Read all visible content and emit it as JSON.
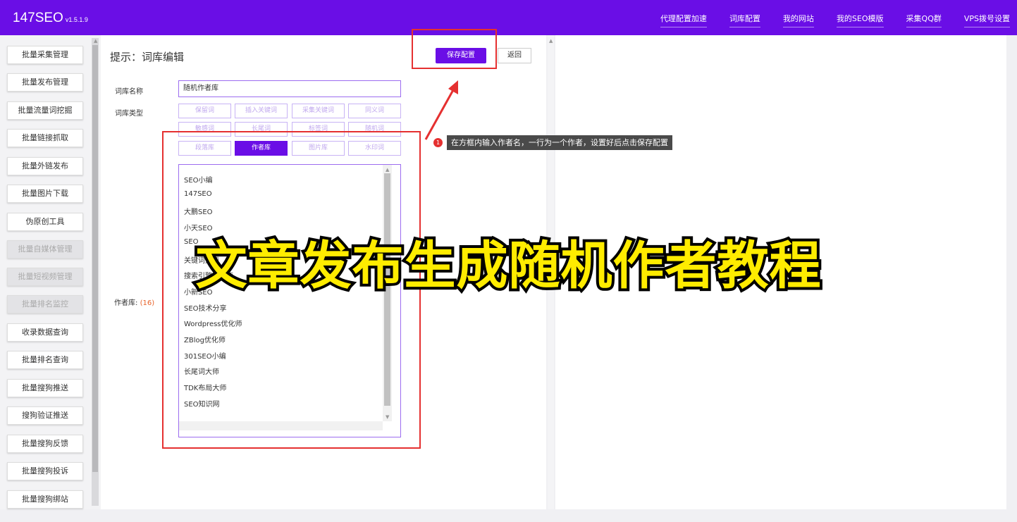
{
  "header": {
    "brand": "147SEO",
    "version": "v1.5.1.9",
    "nav": [
      "代理配置加速",
      "词库配置",
      "我的网站",
      "我的SEO模版",
      "采集QQ群",
      "VPS拨号设置"
    ]
  },
  "sidebar": {
    "items": [
      {
        "label": "批量采集管理",
        "disabled": false
      },
      {
        "label": "批量发布管理",
        "disabled": false
      },
      {
        "label": "批量流量词挖掘",
        "disabled": false
      },
      {
        "label": "批量链接抓取",
        "disabled": false
      },
      {
        "label": "批量外链发布",
        "disabled": false
      },
      {
        "label": "批量图片下载",
        "disabled": false
      },
      {
        "label": "伪原创工具",
        "disabled": false
      },
      {
        "label": "批量自媒体管理",
        "disabled": true
      },
      {
        "label": "批量短视频管理",
        "disabled": true
      },
      {
        "label": "批量排名监控",
        "disabled": true
      },
      {
        "label": "收录数据查询",
        "disabled": false
      },
      {
        "label": "批量排名查询",
        "disabled": false
      },
      {
        "label": "批量搜狗推送",
        "disabled": false
      },
      {
        "label": "搜狗验证推送",
        "disabled": false
      },
      {
        "label": "批量搜狗反馈",
        "disabled": false
      },
      {
        "label": "批量搜狗投诉",
        "disabled": false
      },
      {
        "label": "批量搜狗绑站",
        "disabled": false
      }
    ]
  },
  "main": {
    "hint": "提示：词库编辑",
    "save_label": "保存配置",
    "back_label": "返回",
    "name_label": "词库名称",
    "name_value": "随机作者库",
    "type_label": "词库类型",
    "types": [
      "保留词",
      "插入关键词",
      "采集关键词",
      "同义词",
      "敏感词",
      "长尾词",
      "标签词",
      "随机词",
      "段落库",
      "作者库",
      "图片库",
      "水印词"
    ],
    "active_type": "作者库",
    "lib_label": "作者库:",
    "lib_count": "(16)",
    "authors": [
      "SEO小编",
      "147SEO",
      "大鹏SEO",
      "小天SEO",
      "SEO",
      "关键词大师",
      "搜索引擎优化师",
      "小新SEO",
      "SEO技术分享",
      "Wordpress优化师",
      "ZBlog优化师",
      "301SEO小编",
      "长尾词大师",
      "TDK布局大师",
      "SEO知识网"
    ]
  },
  "annotation": {
    "badge": "1",
    "tooltip": "在方框内输入作者名，一行为一个作者，设置好后点击保存配置",
    "overlay_title": "文章发布生成随机作者教程",
    "color": "#e53030"
  }
}
